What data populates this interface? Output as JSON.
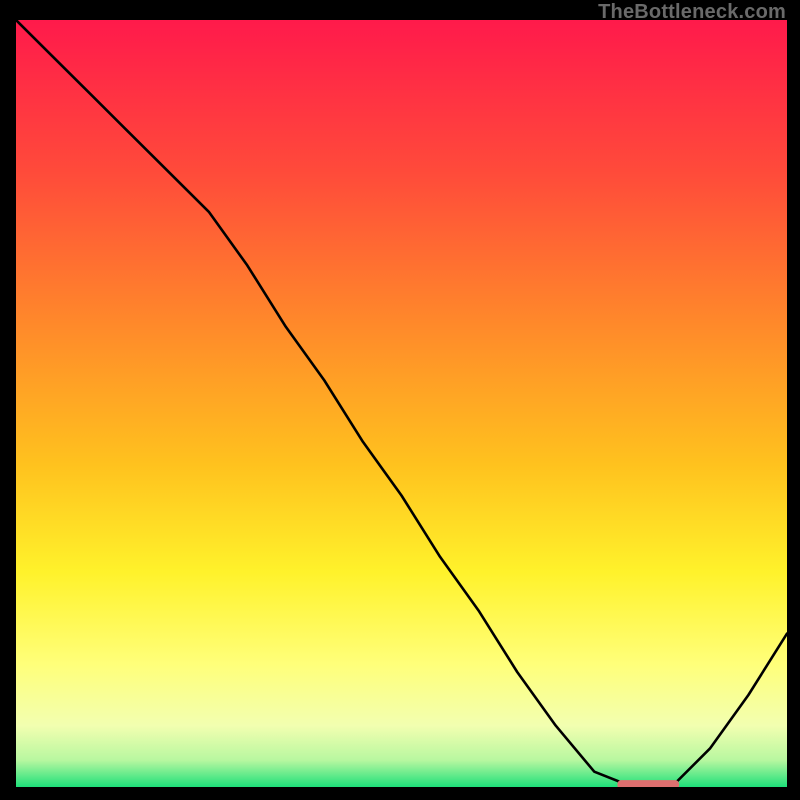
{
  "watermark": "TheBottleneck.com",
  "chart_data": {
    "type": "line",
    "title": "",
    "xlabel": "",
    "ylabel": "",
    "xlim": [
      0,
      100
    ],
    "ylim": [
      0,
      100
    ],
    "grid": false,
    "legend": false,
    "series": [
      {
        "name": "bottleneck-curve",
        "x": [
          0,
          5,
          10,
          15,
          20,
          25,
          30,
          35,
          40,
          45,
          50,
          55,
          60,
          65,
          70,
          75,
          80,
          82,
          85,
          90,
          95,
          100
        ],
        "y": [
          100,
          95,
          90,
          85,
          80,
          75,
          68,
          60,
          53,
          45,
          38,
          30,
          23,
          15,
          8,
          2,
          0,
          0,
          0,
          5,
          12,
          20
        ]
      }
    ],
    "marker": {
      "name": "optimal-segment",
      "shape": "rounded-bar",
      "color": "#dd6f6f",
      "x_start": 78,
      "x_end": 86,
      "y": 0.3,
      "thickness": 1.2
    },
    "background_gradient": {
      "type": "vertical",
      "stops": [
        {
          "pos": 0.0,
          "color": "#ff1a4b"
        },
        {
          "pos": 0.2,
          "color": "#ff4b3a"
        },
        {
          "pos": 0.4,
          "color": "#ff8a2a"
        },
        {
          "pos": 0.58,
          "color": "#ffc21e"
        },
        {
          "pos": 0.72,
          "color": "#fff22b"
        },
        {
          "pos": 0.84,
          "color": "#ffff7a"
        },
        {
          "pos": 0.92,
          "color": "#f2ffb0"
        },
        {
          "pos": 0.965,
          "color": "#b8f7a0"
        },
        {
          "pos": 1.0,
          "color": "#1ee07a"
        }
      ]
    }
  }
}
